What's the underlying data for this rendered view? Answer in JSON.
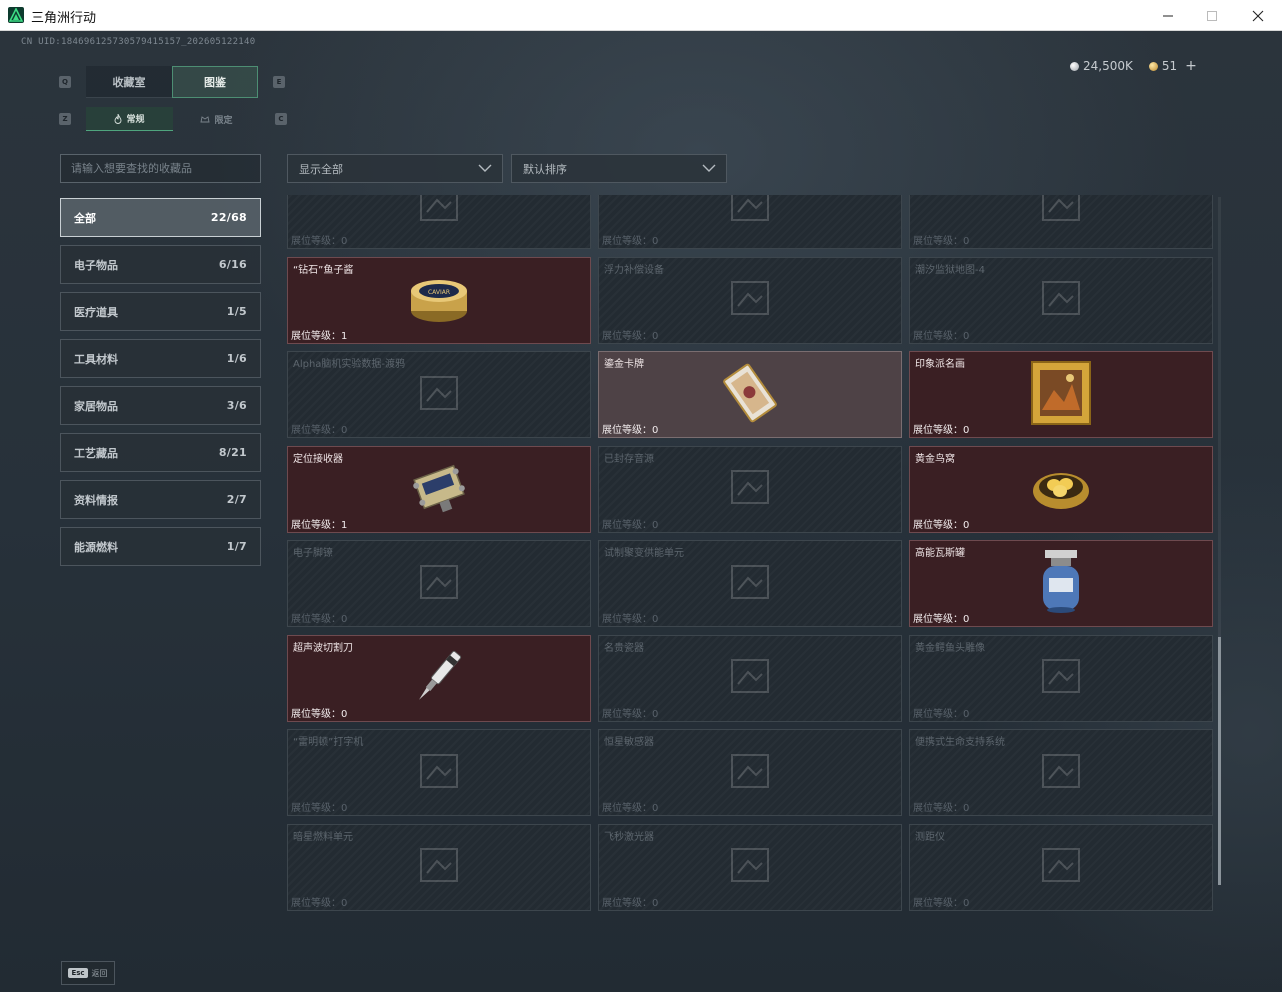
{
  "window": {
    "title": "三角洲行动"
  },
  "header": {
    "uid": "CN UID:184696125730579415157_202605122140",
    "currency": [
      {
        "icon": "silver-coin-icon",
        "amount": "24,500K"
      },
      {
        "icon": "gold-coin-icon",
        "amount": "51"
      }
    ],
    "plus_label": "+"
  },
  "tabs": {
    "main": [
      {
        "label": "收藏室",
        "active": false
      },
      {
        "label": "图鉴",
        "active": true
      }
    ],
    "main_left_key": "Q",
    "main_right_key": "E",
    "sub": [
      {
        "label": "常规",
        "active": true,
        "icon": "flame-icon"
      },
      {
        "label": "限定",
        "active": false,
        "icon": "limited-icon"
      }
    ],
    "sub_left_key": "Z",
    "sub_right_key": "C"
  },
  "search": {
    "placeholder": "请输入想要查找的收藏品",
    "value": ""
  },
  "filters": {
    "show": "显示全部",
    "sort": "默认排序"
  },
  "categories": [
    {
      "label": "全部",
      "count": "22/68",
      "active": true
    },
    {
      "label": "电子物品",
      "count": "6/16"
    },
    {
      "label": "医疗道具",
      "count": "1/5"
    },
    {
      "label": "工具材料",
      "count": "1/6"
    },
    {
      "label": "家居物品",
      "count": "3/6"
    },
    {
      "label": "工艺藏品",
      "count": "8/21"
    },
    {
      "label": "资料情报",
      "count": "2/7"
    },
    {
      "label": "能源燃料",
      "count": "1/7"
    }
  ],
  "grid": {
    "level_prefix": "展位等级：",
    "items": [
      {
        "name": "",
        "level": "0",
        "state": "locked",
        "icon": "vase-icon"
      },
      {
        "name": "",
        "level": "0",
        "state": "locked",
        "icon": "machine-icon"
      },
      {
        "name": "",
        "level": "0",
        "state": "locked",
        "icon": "device-icon"
      },
      {
        "name": "“钻石”鱼子酱",
        "level": "1",
        "state": "owned",
        "icon": "caviar-tin-icon"
      },
      {
        "name": "浮力补偿设备",
        "level": "0",
        "state": "locked",
        "icon": "bcd-vest-icon"
      },
      {
        "name": "潮汐监狱地图-4",
        "level": "0",
        "state": "locked",
        "icon": "map-icon"
      },
      {
        "name": "Alpha脑机实验数据-渡鸦",
        "level": "0",
        "state": "locked",
        "icon": "data-drive-icon"
      },
      {
        "name": "鎏金卡牌",
        "level": "0",
        "state": "owned-gray",
        "icon": "gilded-card-icon"
      },
      {
        "name": "印象派名画",
        "level": "0",
        "state": "owned",
        "icon": "painting-icon"
      },
      {
        "name": "定位接收器",
        "level": "1",
        "state": "owned",
        "icon": "receiver-icon"
      },
      {
        "name": "已封存音源",
        "level": "0",
        "state": "locked",
        "icon": "audio-source-icon"
      },
      {
        "name": "黄金鸟窝",
        "level": "0",
        "state": "owned",
        "icon": "golden-nest-icon"
      },
      {
        "name": "电子脚镣",
        "level": "0",
        "state": "locked",
        "icon": "ankle-monitor-icon"
      },
      {
        "name": "试制聚变供能单元",
        "level": "0",
        "state": "locked",
        "icon": "fusion-cell-icon"
      },
      {
        "name": "高能瓦斯罐",
        "level": "0",
        "state": "owned",
        "icon": "gas-canister-icon"
      },
      {
        "name": "超声波切割刀",
        "level": "0",
        "state": "owned",
        "icon": "ultrasonic-knife-icon"
      },
      {
        "name": "名贵瓷器",
        "level": "0",
        "state": "locked",
        "icon": "porcelain-icon"
      },
      {
        "name": "黄金鳄鱼头雕像",
        "level": "0",
        "state": "locked",
        "icon": "croc-statue-icon"
      },
      {
        "name": "“雷明顿”打字机",
        "level": "0",
        "state": "locked",
        "icon": "typewriter-icon"
      },
      {
        "name": "恒星敏感器",
        "level": "0",
        "state": "locked",
        "icon": "star-sensor-icon"
      },
      {
        "name": "便携式生命支持系统",
        "level": "0",
        "state": "locked",
        "icon": "life-support-icon"
      },
      {
        "name": "暗星燃料单元",
        "level": "0",
        "state": "locked",
        "icon": "fuel-cell-icon"
      },
      {
        "name": "飞秒激光器",
        "level": "0",
        "state": "locked",
        "icon": "laser-icon"
      },
      {
        "name": "测距仪",
        "level": "0",
        "state": "locked",
        "icon": "rangefinder-icon"
      }
    ]
  },
  "footer": {
    "esc_key": "Esc",
    "back_label": "返回"
  },
  "colors": {
    "owned_card": "#3a1f23",
    "owned_gray_card": "#4e4246",
    "locked_card": "#232b32",
    "accent_green": "#4d8e73"
  }
}
